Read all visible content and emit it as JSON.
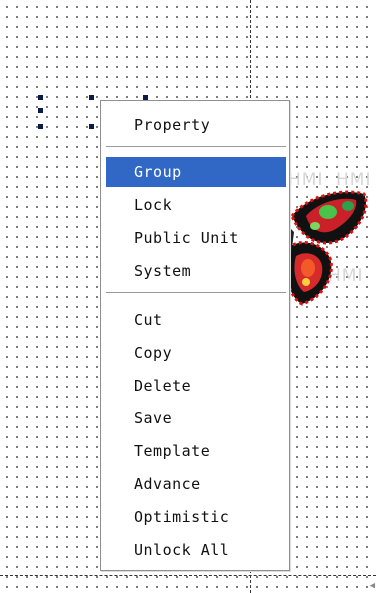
{
  "canvas": {
    "watermark_text": "HMI"
  },
  "context_menu": {
    "groups": [
      {
        "items": [
          {
            "label": "Property",
            "selected": false
          }
        ]
      },
      {
        "items": [
          {
            "label": "Group",
            "selected": true
          },
          {
            "label": "Lock",
            "selected": false
          },
          {
            "label": "Public Unit",
            "selected": false
          },
          {
            "label": "System",
            "selected": false
          }
        ]
      },
      {
        "items": [
          {
            "label": "Cut",
            "selected": false
          },
          {
            "label": "Copy",
            "selected": false
          },
          {
            "label": "Delete",
            "selected": false
          },
          {
            "label": "Save",
            "selected": false
          },
          {
            "label": "Template",
            "selected": false
          },
          {
            "label": "Advance",
            "selected": false
          },
          {
            "label": "Optimistic",
            "selected": false
          },
          {
            "label": "Unlock All",
            "selected": false
          }
        ]
      }
    ]
  },
  "colors": {
    "selection": "#3168c6",
    "handle": "#0c1a4a"
  }
}
